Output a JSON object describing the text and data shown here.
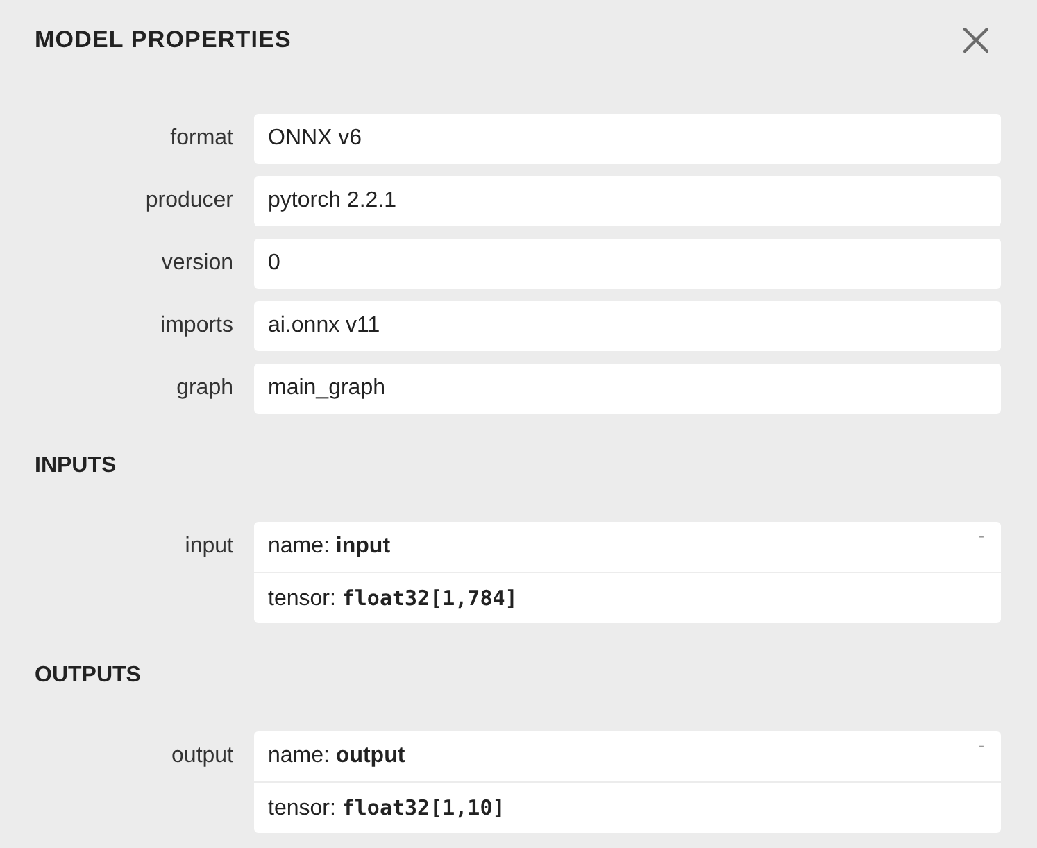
{
  "window": {
    "title": "MODEL PROPERTIES"
  },
  "properties": [
    {
      "label": "format",
      "value": "ONNX v6"
    },
    {
      "label": "producer",
      "value": "pytorch 2.2.1"
    },
    {
      "label": "version",
      "value": "0"
    },
    {
      "label": "imports",
      "value": "ai.onnx v11"
    },
    {
      "label": "graph",
      "value": "main_graph"
    }
  ],
  "sections": [
    {
      "heading": "INPUTS",
      "arguments": [
        {
          "label": "input",
          "toggle": "-",
          "lines": [
            {
              "key": "name:",
              "value": "input",
              "kind": "name"
            },
            {
              "key": "tensor:",
              "value": "float32[1,784]",
              "kind": "type"
            }
          ]
        }
      ]
    },
    {
      "heading": "OUTPUTS",
      "arguments": [
        {
          "label": "output",
          "toggle": "-",
          "lines": [
            {
              "key": "name:",
              "value": "output",
              "kind": "name"
            },
            {
              "key": "tensor:",
              "value": "float32[1,10]",
              "kind": "type"
            }
          ]
        }
      ]
    }
  ]
}
